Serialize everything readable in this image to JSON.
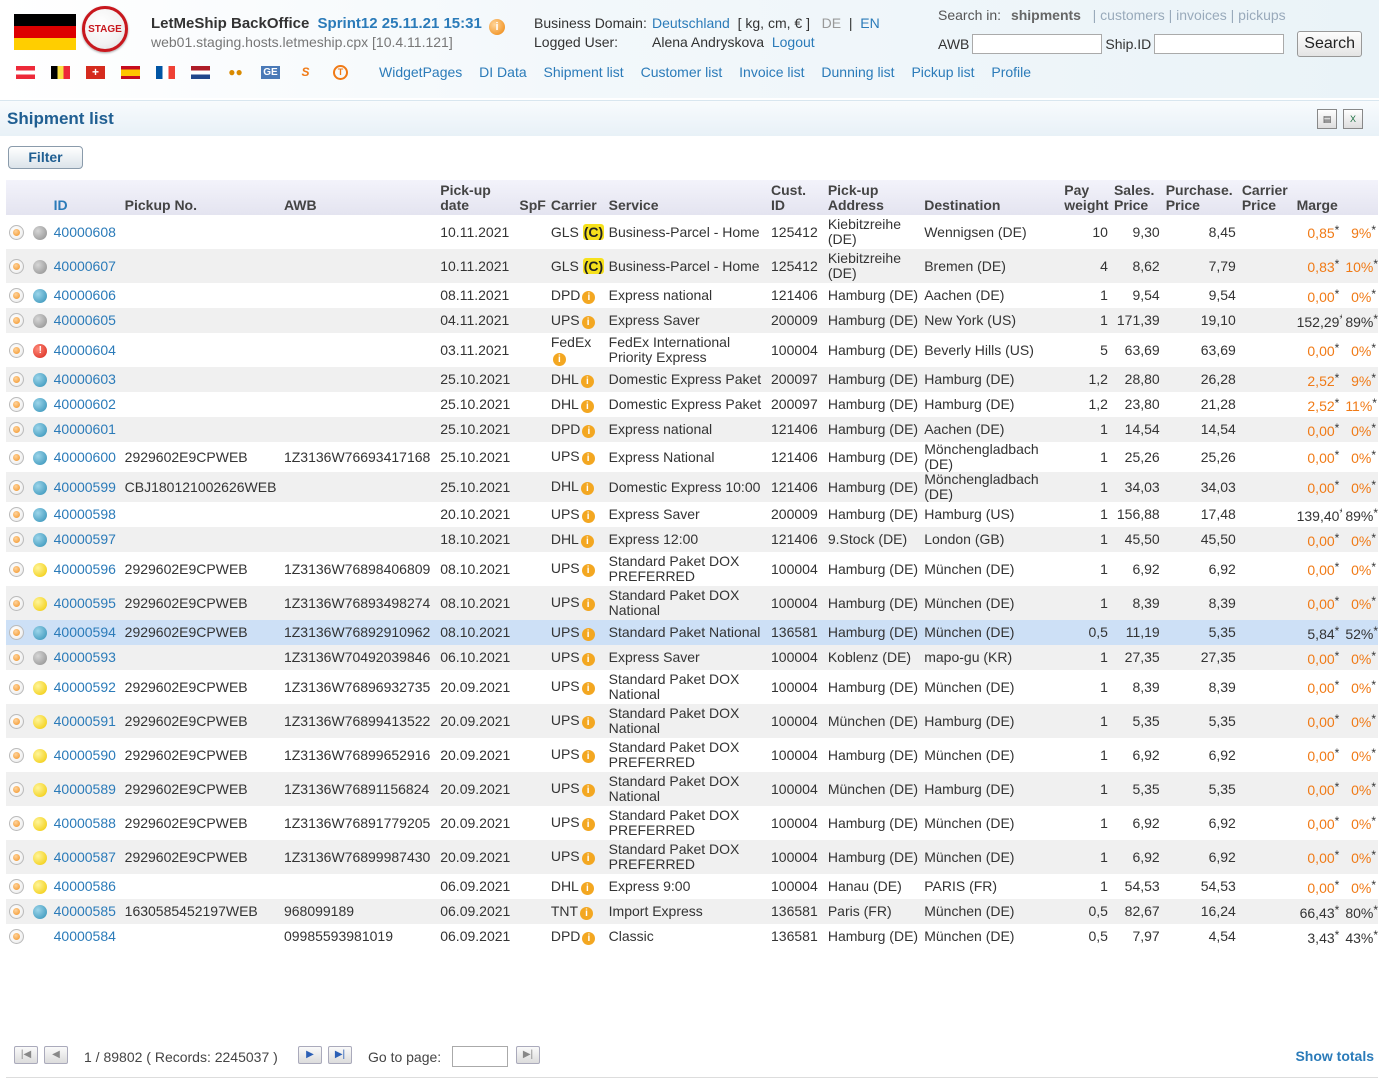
{
  "header": {
    "app_name": "LetMeShip BackOffice",
    "sprint": "Sprint12 25.11.21 15:31",
    "host": "web01.staging.hosts.letmeship.cpx [10.4.11.121]",
    "stage_label": "STAGE",
    "business_domain_label": "Business Domain:",
    "business_domain_value": "Deutschland",
    "units": "[ kg, cm, € ]",
    "lang_de": "DE",
    "lang_sep": "|",
    "lang_en": "EN",
    "logged_user_label": "Logged User:",
    "logged_user": "Alena Andryskova",
    "logout": "Logout",
    "colors": {
      "accent": "#2b7bb9",
      "title": "#205f92",
      "orange": "#f07a16",
      "selected_row": "#cde0f6"
    }
  },
  "search": {
    "label": "Search in:",
    "active": "shipments",
    "others": [
      "customers",
      "invoices",
      "pickups"
    ],
    "awb_label": "AWB",
    "awb_value": "",
    "shipid_label": "Ship.ID",
    "shipid_value": "",
    "button": "Search"
  },
  "mini_icons": [
    "flag-at",
    "flag-be",
    "flag-ch",
    "flag-es",
    "flag-fr",
    "flag-nl",
    "wallet-icon",
    "ge-icon",
    "s-icon",
    "t-icon"
  ],
  "nav": [
    "WidgetPages",
    "DI Data",
    "Shipment list",
    "Customer list",
    "Invoice list",
    "Dunning list",
    "Pickup list",
    "Profile"
  ],
  "page": {
    "title": "Shipment list",
    "filter_button": "Filter",
    "export_icons": [
      "print-icon",
      "excel-export-icon"
    ]
  },
  "columns": [
    "ID",
    "Pickup No.",
    "AWB",
    "Pick-up date",
    "SpF",
    "Carrier",
    "Service",
    "Cust. ID",
    "Pick-up Address",
    "Destination",
    "Pay weight",
    "Sales. Price",
    "Purchase. Price",
    "Carrier Price",
    "Marge"
  ],
  "rows": [
    {
      "status": "grey",
      "id": "40000608",
      "pickup_no": "",
      "awb": "",
      "date": "10.11.2021",
      "carrier": "GLS",
      "carrier_badge": "(C)",
      "carrier_info": false,
      "service": "Business-Parcel - Home",
      "cust_id": "125412",
      "pickup_addr": "Kiebitzreihe (DE)",
      "destination": "Wennigsen (DE)",
      "weight": "10",
      "sales": "9,30",
      "purchase": "8,45",
      "marge": "0,85",
      "marge_pct": "9%",
      "orange": true
    },
    {
      "status": "grey",
      "id": "40000607",
      "pickup_no": "",
      "awb": "",
      "date": "10.11.2021",
      "carrier": "GLS",
      "carrier_badge": "(C)",
      "carrier_info": false,
      "service": "Business-Parcel - Home",
      "cust_id": "125412",
      "pickup_addr": "Kiebitzreihe (DE)",
      "destination": "Bremen (DE)",
      "weight": "4",
      "sales": "8,62",
      "purchase": "7,79",
      "marge": "0,83",
      "marge_pct": "10%",
      "orange": true
    },
    {
      "status": "blue",
      "id": "40000606",
      "pickup_no": "",
      "awb": "",
      "date": "08.11.2021",
      "carrier": "DPD",
      "carrier_badge": "",
      "carrier_info": true,
      "service": "Express national",
      "cust_id": "121406",
      "pickup_addr": "Hamburg (DE)",
      "destination": "Aachen (DE)",
      "weight": "1",
      "sales": "9,54",
      "purchase": "9,54",
      "marge": "0,00",
      "marge_pct": "0%",
      "orange": true
    },
    {
      "status": "grey",
      "id": "40000605",
      "pickup_no": "",
      "awb": "",
      "date": "04.11.2021",
      "carrier": "UPS",
      "carrier_badge": "",
      "carrier_info": true,
      "service": "Express Saver",
      "cust_id": "200009",
      "pickup_addr": "Hamburg (DE)",
      "destination": "New York (US)",
      "weight": "1",
      "sales": "171,39",
      "purchase": "19,10",
      "marge": "152,29",
      "marge_pct": "89%",
      "orange": false
    },
    {
      "status": "red",
      "id": "40000604",
      "pickup_no": "",
      "awb": "",
      "date": "03.11.2021",
      "carrier": "FedEx",
      "carrier_badge": "",
      "carrier_info": true,
      "service": "FedEx International Priority Express",
      "cust_id": "100004",
      "pickup_addr": "Hamburg (DE)",
      "destination": "Beverly Hills (US)",
      "weight": "5",
      "sales": "63,69",
      "purchase": "63,69",
      "marge": "0,00",
      "marge_pct": "0%",
      "orange": true
    },
    {
      "status": "blue",
      "id": "40000603",
      "pickup_no": "",
      "awb": "",
      "date": "25.10.2021",
      "carrier": "DHL",
      "carrier_badge": "",
      "carrier_info": true,
      "service": "Domestic Express Paket",
      "cust_id": "200097",
      "pickup_addr": "Hamburg (DE)",
      "destination": "Hamburg (DE)",
      "weight": "1,2",
      "sales": "28,80",
      "purchase": "26,28",
      "marge": "2,52",
      "marge_pct": "9%",
      "orange": true
    },
    {
      "status": "blue",
      "id": "40000602",
      "pickup_no": "",
      "awb": "",
      "date": "25.10.2021",
      "carrier": "DHL",
      "carrier_badge": "",
      "carrier_info": true,
      "service": "Domestic Express Paket",
      "cust_id": "200097",
      "pickup_addr": "Hamburg (DE)",
      "destination": "Hamburg (DE)",
      "weight": "1,2",
      "sales": "23,80",
      "purchase": "21,28",
      "marge": "2,52",
      "marge_pct": "11%",
      "orange": true
    },
    {
      "status": "blue",
      "id": "40000601",
      "pickup_no": "",
      "awb": "",
      "date": "25.10.2021",
      "carrier": "DPD",
      "carrier_badge": "",
      "carrier_info": true,
      "service": "Express national",
      "cust_id": "121406",
      "pickup_addr": "Hamburg (DE)",
      "destination": "Aachen (DE)",
      "weight": "1",
      "sales": "14,54",
      "purchase": "14,54",
      "marge": "0,00",
      "marge_pct": "0%",
      "orange": true
    },
    {
      "status": "blue",
      "id": "40000600",
      "pickup_no": "2929602E9CPWEB",
      "awb": "1Z3136W76693417168",
      "date": "25.10.2021",
      "carrier": "UPS",
      "carrier_badge": "",
      "carrier_info": true,
      "service": "Express National",
      "cust_id": "121406",
      "pickup_addr": "Hamburg (DE)",
      "destination": "Mönchengladbach (DE)",
      "weight": "1",
      "sales": "25,26",
      "purchase": "25,26",
      "marge": "0,00",
      "marge_pct": "0%",
      "orange": true
    },
    {
      "status": "blue",
      "id": "40000599",
      "pickup_no": "CBJ180121002626WEB",
      "awb": "",
      "date": "25.10.2021",
      "carrier": "DHL",
      "carrier_badge": "",
      "carrier_info": true,
      "service": "Domestic Express 10:00",
      "cust_id": "121406",
      "pickup_addr": "Hamburg (DE)",
      "destination": "Mönchengladbach (DE)",
      "weight": "1",
      "sales": "34,03",
      "purchase": "34,03",
      "marge": "0,00",
      "marge_pct": "0%",
      "orange": true
    },
    {
      "status": "blue",
      "id": "40000598",
      "pickup_no": "",
      "awb": "",
      "date": "20.10.2021",
      "carrier": "UPS",
      "carrier_badge": "",
      "carrier_info": true,
      "service": "Express Saver",
      "cust_id": "200009",
      "pickup_addr": "Hamburg (DE)",
      "destination": "Hamburg (US)",
      "weight": "1",
      "sales": "156,88",
      "purchase": "17,48",
      "marge": "139,40",
      "marge_pct": "89%",
      "orange": false
    },
    {
      "status": "blue",
      "id": "40000597",
      "pickup_no": "",
      "awb": "",
      "date": "18.10.2021",
      "carrier": "DHL",
      "carrier_badge": "",
      "carrier_info": true,
      "service": "Express 12:00",
      "cust_id": "121406",
      "pickup_addr": "9.Stock (DE)",
      "destination": "London (GB)",
      "weight": "1",
      "sales": "45,50",
      "purchase": "45,50",
      "marge": "0,00",
      "marge_pct": "0%",
      "orange": true
    },
    {
      "status": "yellow",
      "id": "40000596",
      "pickup_no": "2929602E9CPWEB",
      "awb": "1Z3136W76898406809",
      "date": "08.10.2021",
      "carrier": "UPS",
      "carrier_badge": "",
      "carrier_info": true,
      "service": "Standard Paket DOX PREFERRED",
      "cust_id": "100004",
      "pickup_addr": "Hamburg (DE)",
      "destination": "München (DE)",
      "weight": "1",
      "sales": "6,92",
      "purchase": "6,92",
      "marge": "0,00",
      "marge_pct": "0%",
      "orange": true
    },
    {
      "status": "yellow",
      "id": "40000595",
      "pickup_no": "2929602E9CPWEB",
      "awb": "1Z3136W76893498274",
      "date": "08.10.2021",
      "carrier": "UPS",
      "carrier_badge": "",
      "carrier_info": true,
      "service": "Standard Paket DOX National",
      "cust_id": "100004",
      "pickup_addr": "Hamburg (DE)",
      "destination": "München (DE)",
      "weight": "1",
      "sales": "8,39",
      "purchase": "8,39",
      "marge": "0,00",
      "marge_pct": "0%",
      "orange": true
    },
    {
      "status": "blue",
      "id": "40000594",
      "pickup_no": "2929602E9CPWEB",
      "awb": "1Z3136W76892910962",
      "date": "08.10.2021",
      "carrier": "UPS",
      "carrier_badge": "",
      "carrier_info": true,
      "service": "Standard Paket National",
      "cust_id": "136581",
      "pickup_addr": "Hamburg (DE)",
      "destination": "München (DE)",
      "weight": "0,5",
      "sales": "11,19",
      "purchase": "5,35",
      "marge": "5,84",
      "marge_pct": "52%",
      "orange": false,
      "selected": true
    },
    {
      "status": "grey",
      "id": "40000593",
      "pickup_no": "",
      "awb": "1Z3136W70492039846",
      "date": "06.10.2021",
      "carrier": "UPS",
      "carrier_badge": "",
      "carrier_info": true,
      "service": "Express Saver",
      "cust_id": "100004",
      "pickup_addr": "Koblenz (DE)",
      "destination": "mapo-gu (KR)",
      "weight": "1",
      "sales": "27,35",
      "purchase": "27,35",
      "marge": "0,00",
      "marge_pct": "0%",
      "orange": true
    },
    {
      "status": "yellow",
      "id": "40000592",
      "pickup_no": "2929602E9CPWEB",
      "awb": "1Z3136W76896932735",
      "date": "20.09.2021",
      "carrier": "UPS",
      "carrier_badge": "",
      "carrier_info": true,
      "service": "Standard Paket DOX National",
      "cust_id": "100004",
      "pickup_addr": "Hamburg (DE)",
      "destination": "München (DE)",
      "weight": "1",
      "sales": "8,39",
      "purchase": "8,39",
      "marge": "0,00",
      "marge_pct": "0%",
      "orange": true
    },
    {
      "status": "yellow",
      "id": "40000591",
      "pickup_no": "2929602E9CPWEB",
      "awb": "1Z3136W76899413522",
      "date": "20.09.2021",
      "carrier": "UPS",
      "carrier_badge": "",
      "carrier_info": true,
      "service": "Standard Paket DOX National",
      "cust_id": "100004",
      "pickup_addr": "München (DE)",
      "destination": "Hamburg (DE)",
      "weight": "1",
      "sales": "5,35",
      "purchase": "5,35",
      "marge": "0,00",
      "marge_pct": "0%",
      "orange": true
    },
    {
      "status": "yellow",
      "id": "40000590",
      "pickup_no": "2929602E9CPWEB",
      "awb": "1Z3136W76899652916",
      "date": "20.09.2021",
      "carrier": "UPS",
      "carrier_badge": "",
      "carrier_info": true,
      "service": "Standard Paket DOX PREFERRED",
      "cust_id": "100004",
      "pickup_addr": "Hamburg (DE)",
      "destination": "München (DE)",
      "weight": "1",
      "sales": "6,92",
      "purchase": "6,92",
      "marge": "0,00",
      "marge_pct": "0%",
      "orange": true
    },
    {
      "status": "yellow",
      "id": "40000589",
      "pickup_no": "2929602E9CPWEB",
      "awb": "1Z3136W76891156824",
      "date": "20.09.2021",
      "carrier": "UPS",
      "carrier_badge": "",
      "carrier_info": true,
      "service": "Standard Paket DOX National",
      "cust_id": "100004",
      "pickup_addr": "München (DE)",
      "destination": "Hamburg (DE)",
      "weight": "1",
      "sales": "5,35",
      "purchase": "5,35",
      "marge": "0,00",
      "marge_pct": "0%",
      "orange": true
    },
    {
      "status": "yellow",
      "id": "40000588",
      "pickup_no": "2929602E9CPWEB",
      "awb": "1Z3136W76891779205",
      "date": "20.09.2021",
      "carrier": "UPS",
      "carrier_badge": "",
      "carrier_info": true,
      "service": "Standard Paket DOX PREFERRED",
      "cust_id": "100004",
      "pickup_addr": "Hamburg (DE)",
      "destination": "München (DE)",
      "weight": "1",
      "sales": "6,92",
      "purchase": "6,92",
      "marge": "0,00",
      "marge_pct": "0%",
      "orange": true
    },
    {
      "status": "yellow",
      "id": "40000587",
      "pickup_no": "2929602E9CPWEB",
      "awb": "1Z3136W76899987430",
      "date": "20.09.2021",
      "carrier": "UPS",
      "carrier_badge": "",
      "carrier_info": true,
      "service": "Standard Paket DOX PREFERRED",
      "cust_id": "100004",
      "pickup_addr": "Hamburg (DE)",
      "destination": "München (DE)",
      "weight": "1",
      "sales": "6,92",
      "purchase": "6,92",
      "marge": "0,00",
      "marge_pct": "0%",
      "orange": true
    },
    {
      "status": "yellow",
      "id": "40000586",
      "pickup_no": "",
      "awb": "",
      "date": "06.09.2021",
      "carrier": "DHL",
      "carrier_badge": "",
      "carrier_info": true,
      "service": "Express 9:00",
      "cust_id": "100004",
      "pickup_addr": "Hanau (DE)",
      "destination": "PARIS (FR)",
      "weight": "1",
      "sales": "54,53",
      "purchase": "54,53",
      "marge": "0,00",
      "marge_pct": "0%",
      "orange": true
    },
    {
      "status": "blue",
      "id": "40000585",
      "pickup_no": "1630585452197WEB",
      "awb": "968099189",
      "date": "06.09.2021",
      "carrier": "TNT",
      "carrier_badge": "",
      "carrier_info": true,
      "service": "Import Express",
      "cust_id": "136581",
      "pickup_addr": "Paris (FR)",
      "destination": "München (DE)",
      "weight": "0,5",
      "sales": "82,67",
      "purchase": "16,24",
      "marge": "66,43",
      "marge_pct": "80%",
      "orange": false
    },
    {
      "status": "",
      "id": "40000584",
      "pickup_no": "",
      "awb": "09985593981019",
      "date": "06.09.2021",
      "carrier": "DPD",
      "carrier_badge": "",
      "carrier_info": true,
      "service": "Classic",
      "cust_id": "136581",
      "pickup_addr": "Hamburg (DE)",
      "destination": "München (DE)",
      "weight": "0,5",
      "sales": "7,97",
      "purchase": "4,54",
      "marge": "3,43",
      "marge_pct": "43%",
      "orange": false
    }
  ],
  "pager": {
    "page_info": "1 / 89802 ( Records: 2245037 )",
    "goto_label": "Go to page:",
    "goto_value": "",
    "show_totals": "Show totals"
  }
}
